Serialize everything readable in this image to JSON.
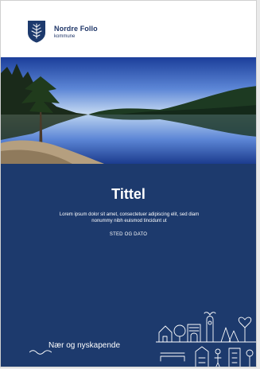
{
  "header": {
    "logo_name": "Nordre Follo",
    "logo_subtitle": "kommune"
  },
  "cover": {
    "title": "Tittel",
    "body": "Lorem ipsum dolor sit amet, consectetuer adipiscing elit, sed diam nonummy nibh euismod tincidunt ut",
    "place_date": "STED OG DATO",
    "slogan": "Nær og nyskapende"
  },
  "colors": {
    "navy": "#1d3a6d",
    "white": "#ffffff"
  },
  "icons": {
    "logo": "municipal-shield-icon",
    "wave": "wave-line-icon",
    "townscape": "townscape-illustration"
  }
}
